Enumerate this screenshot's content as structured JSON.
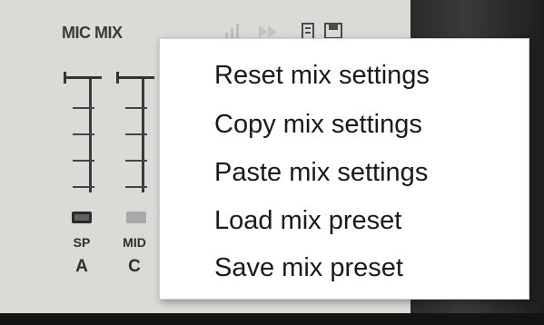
{
  "panel": {
    "title": "MIC MIX",
    "channels": [
      {
        "short": "SP",
        "letter": "A"
      },
      {
        "short": "MID",
        "letter": "C"
      }
    ]
  },
  "context_menu": {
    "items": [
      {
        "label": "Reset mix settings"
      },
      {
        "label": "Copy mix settings"
      },
      {
        "label": "Paste mix settings"
      },
      {
        "label": "Load mix preset"
      },
      {
        "label": "Save mix preset"
      }
    ]
  },
  "icons": {
    "header": [
      "meter-bars-icon",
      "skip-icon",
      "load-preset-icon",
      "save-preset-icon"
    ]
  },
  "colors": {
    "panel_bg": "#dcdad6",
    "menu_bg": "#ffffff",
    "text": "#1a1a1a"
  }
}
